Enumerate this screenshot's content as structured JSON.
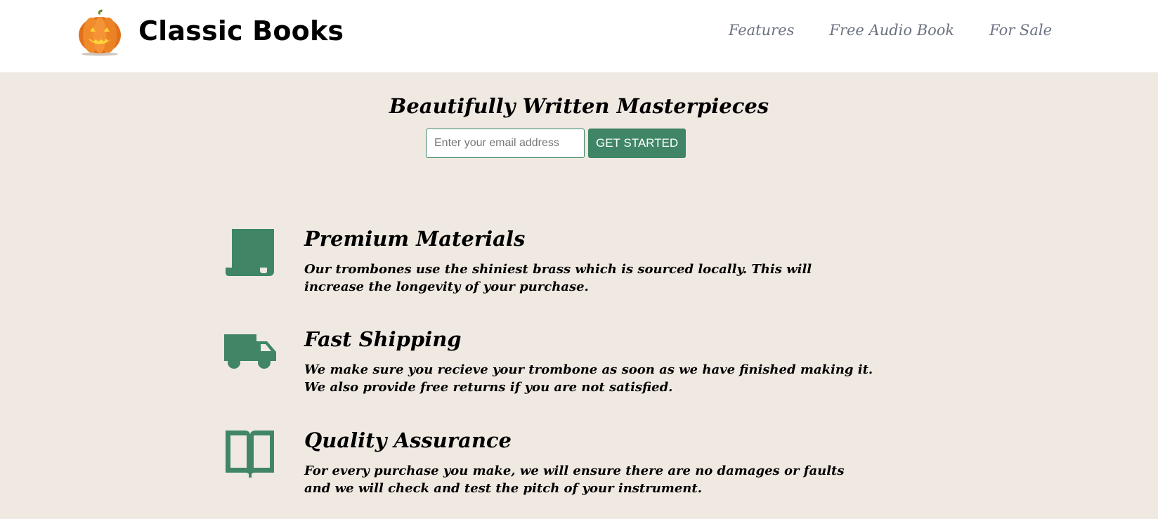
{
  "header": {
    "logo_icon": "pumpkin-icon",
    "brand": "Classic Books",
    "nav": [
      {
        "label": "Features"
      },
      {
        "label": "Free Audio Book"
      },
      {
        "label": "For Sale"
      }
    ]
  },
  "hero": {
    "title": "Beautifully Written Masterpieces",
    "email_placeholder": "Enter your email address",
    "email_value": "",
    "cta_label": "GET STARTED"
  },
  "features": [
    {
      "icon": "scroll-icon",
      "title": "Premium Materials",
      "text": "Our trombones use the shiniest brass which is sourced locally. This will increase the longevity of your purchase."
    },
    {
      "icon": "truck-icon",
      "title": "Fast Shipping",
      "text": "We make sure you recieve your trombone as soon as we have finished making it. We also provide free returns if you are not satisfied."
    },
    {
      "icon": "open-book-icon",
      "title": "Quality Assurance",
      "text": "For every purchase you make, we will ensure there are no damages or faults and we will check and test the pitch of your instrument."
    }
  ],
  "colors": {
    "accent": "#3f8566",
    "background": "#f0e9e2",
    "header_bg": "#ffffff",
    "nav_text": "#6b7180"
  }
}
